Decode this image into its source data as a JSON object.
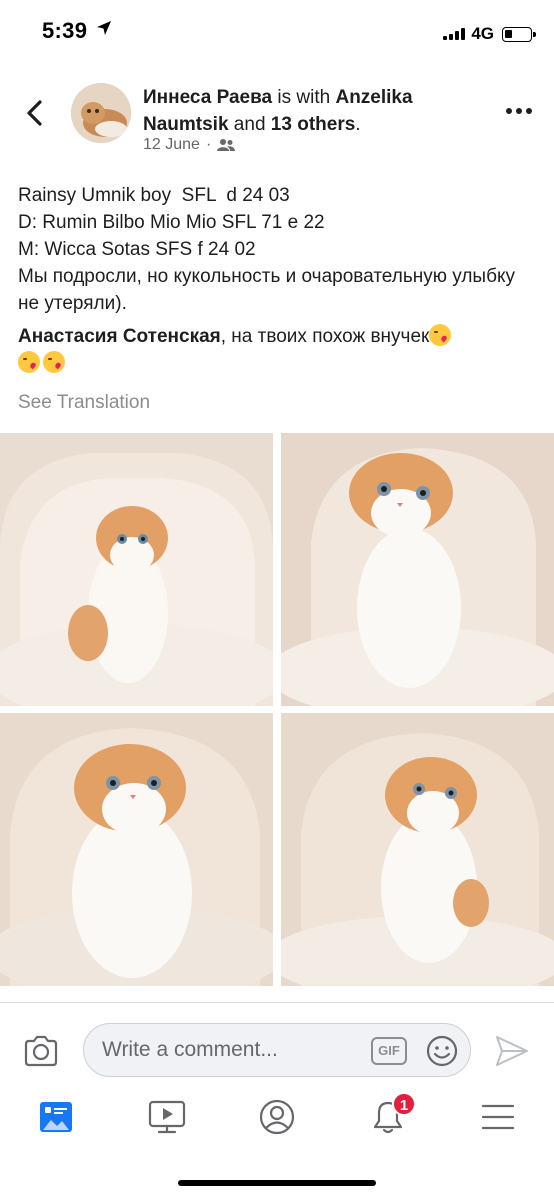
{
  "status_bar": {
    "time": "5:39",
    "network": "4G"
  },
  "post": {
    "author": "Иннеса Раева",
    "with_text": " is with ",
    "tagged": "Anzelika Naumtsik",
    "and_text": " and ",
    "others": "13 others",
    "period": ".",
    "date": "12 June",
    "separator": "·",
    "audience_icon": "friends-icon",
    "body_lines": [
      "Rainsy Umnik boy  SFL  d 24 03",
      "D: Rumin Bilbo Mio Mio SFL 71 e 22",
      "M: Wicca Sotas SFS f 24 02",
      "Мы подросли, но кукольность и очаровательную улыбку не утеряли)."
    ],
    "mention": "Анастасия Сотенская",
    "mention_rest": ", на твоих похож внучек",
    "see_translation": "See Translation",
    "photo_count": 4
  },
  "comment_bar": {
    "placeholder": "Write a comment...",
    "gif_label": "GIF"
  },
  "nav": {
    "items": [
      "news-feed-icon",
      "watch-icon",
      "profile-icon",
      "notifications-icon",
      "menu-icon"
    ],
    "notification_count": "1",
    "active_color": "#1877f2"
  },
  "colors": {
    "text": "#1c1e21",
    "secondary": "#65676b",
    "badge": "#e41e3f"
  }
}
